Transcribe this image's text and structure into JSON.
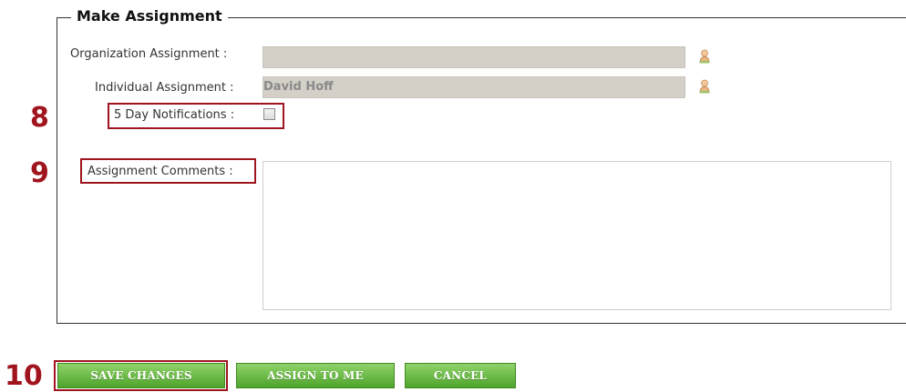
{
  "form": {
    "legend": "Make Assignment",
    "org_assignment_label": "Organization Assignment :",
    "org_assignment_value": "",
    "individual_assignment_label": "Individual Assignment :",
    "individual_assignment_value": "David Hoff",
    "notifications_label": "5 Day Notifications :",
    "notifications_checked": false,
    "comments_label": "Assignment Comments :",
    "comments_value": ""
  },
  "callouts": {
    "notifications": "8",
    "comments": "9",
    "save": "10"
  },
  "buttons": {
    "save_label": "SAVE CHANGES",
    "assign_label": "ASSIGN TO ME",
    "cancel_label": "CANCEL"
  },
  "colors": {
    "callout": "#a0141e",
    "button_green": "#5cb335",
    "readonly_field": "#d4d0c8"
  },
  "icons": {
    "org_picker": "person-icon",
    "individual_picker": "person-icon"
  }
}
